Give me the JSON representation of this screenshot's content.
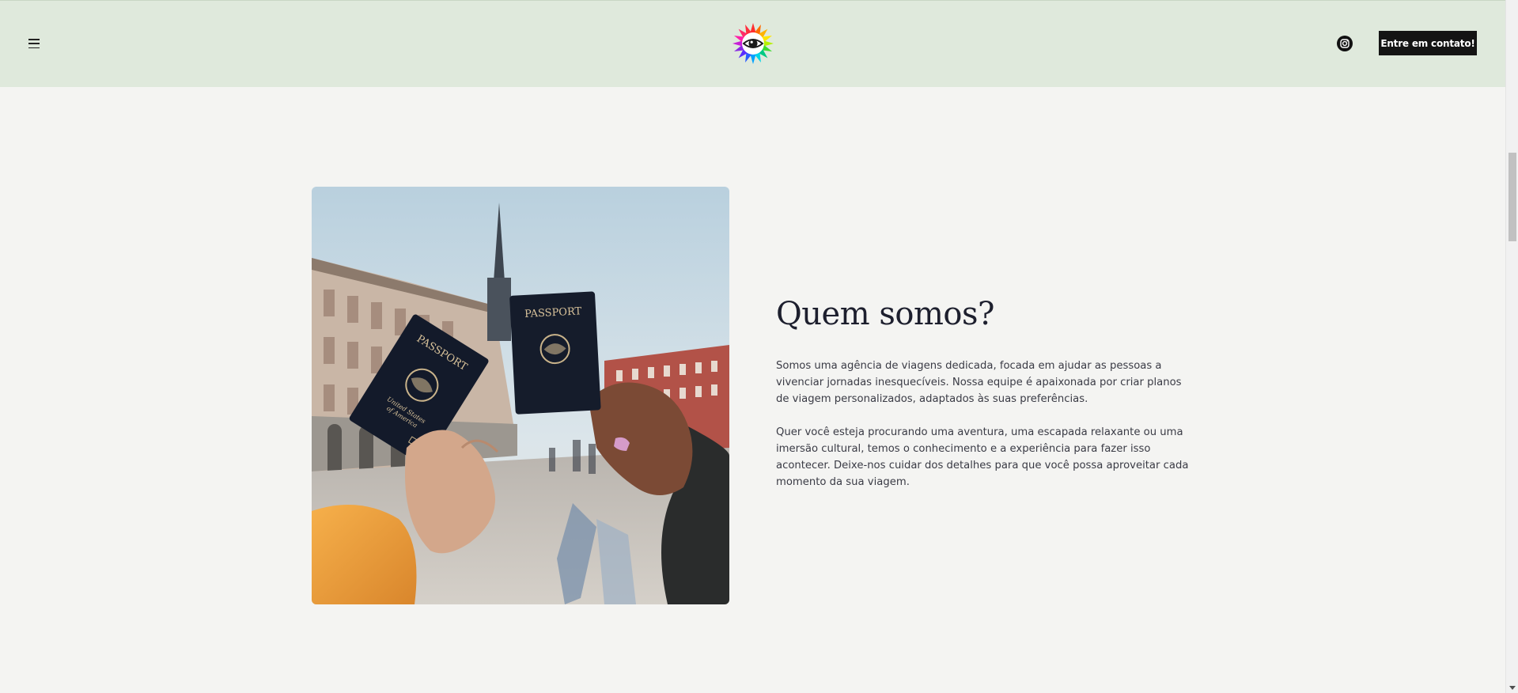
{
  "header": {
    "menu_icon": "hamburger-menu-icon",
    "logo_icon": "eye-flower-logo",
    "social_icon": "instagram-icon",
    "contact_button_label": "Entre em contato!",
    "background_color": "#dfe9dc"
  },
  "about": {
    "image_alt": "Two hands holding United States passports in a city square",
    "title": "Quem somos?",
    "paragraph_1": "Somos uma agência de viagens dedicada, focada em ajudar as pessoas a vivenciar jornadas inesquecíveis. Nossa equipe é apaixonada por criar planos de viagem personalizados, adaptados às suas preferências.",
    "paragraph_2": "Quer você esteja procurando uma aventura, uma escapada relaxante ou uma imersão cultural, temos o conhecimento e a experiência para fazer isso acontecer. Deixe-nos cuidar dos detalhes para que você possa aproveitar cada momento da sua viagem."
  },
  "passport_text": {
    "front": "PASSPORT",
    "back": "PASSPORT",
    "cover_line_1": "United States",
    "cover_line_2": "of America"
  },
  "colors": {
    "page_background": "#f4f4f2",
    "button_background": "#141414",
    "title_color": "#1d1f2e"
  }
}
